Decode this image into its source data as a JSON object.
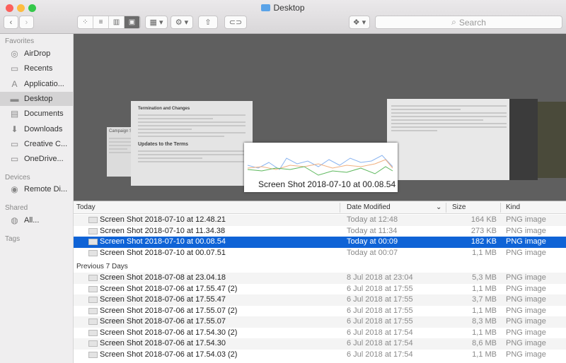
{
  "window": {
    "title": "Desktop"
  },
  "toolbar": {
    "back": "‹",
    "forward": "›",
    "views": [
      "icon-view",
      "list-view",
      "column-view",
      "cover-flow-view"
    ],
    "active_view": "cover-flow-view",
    "search_placeholder": "Search"
  },
  "sidebar": {
    "favorites_label": "Favorites",
    "favorites": [
      {
        "label": "AirDrop",
        "icon": "airdrop-icon"
      },
      {
        "label": "Recents",
        "icon": "recents-icon"
      },
      {
        "label": "Applicatio...",
        "icon": "applications-icon"
      },
      {
        "label": "Desktop",
        "icon": "desktop-icon",
        "selected": true
      },
      {
        "label": "Documents",
        "icon": "documents-icon"
      },
      {
        "label": "Downloads",
        "icon": "downloads-icon"
      },
      {
        "label": "Creative C...",
        "icon": "folder-icon"
      },
      {
        "label": "OneDrive...",
        "icon": "folder-icon"
      }
    ],
    "devices_label": "Devices",
    "devices": [
      {
        "label": "Remote Di...",
        "icon": "disc-icon"
      }
    ],
    "shared_label": "Shared",
    "shared": [
      {
        "label": "All...",
        "icon": "network-icon"
      }
    ],
    "tags_label": "Tags"
  },
  "coverflow": {
    "caption": "Screen Shot 2018-07-10 at 00.08.54",
    "doc_heading1": "Termination and Changes",
    "doc_heading2": "Updates to the Terms",
    "campaign_heading": "Campaign S"
  },
  "list": {
    "columns": {
      "name": "Today",
      "date": "Date Modified",
      "size": "Size",
      "kind": "Kind"
    },
    "groups": [
      {
        "label": "Today",
        "rows": [
          {
            "name": "Screen Shot 2018-07-10 at 12.48.21",
            "date": "Today at 12:48",
            "size": "164 KB",
            "kind": "PNG image"
          },
          {
            "name": "Screen Shot 2018-07-10 at 11.34.38",
            "date": "Today at 11:34",
            "size": "273 KB",
            "kind": "PNG image"
          },
          {
            "name": "Screen Shot 2018-07-10 at 00.08.54",
            "date": "Today at 00:09",
            "size": "182 KB",
            "kind": "PNG image",
            "selected": true
          },
          {
            "name": "Screen Shot 2018-07-10 at 00.07.51",
            "date": "Today at 00:07",
            "size": "1,1 MB",
            "kind": "PNG image"
          }
        ]
      },
      {
        "label": "Previous 7 Days",
        "rows": [
          {
            "name": "Screen Shot 2018-07-08 at 23.04.18",
            "date": "8 Jul 2018 at 23:04",
            "size": "5,3 MB",
            "kind": "PNG image"
          },
          {
            "name": "Screen Shot 2018-07-06 at 17.55.47 (2)",
            "date": "6 Jul 2018 at 17:55",
            "size": "1,1 MB",
            "kind": "PNG image"
          },
          {
            "name": "Screen Shot 2018-07-06 at 17.55.47",
            "date": "6 Jul 2018 at 17:55",
            "size": "3,7 MB",
            "kind": "PNG image"
          },
          {
            "name": "Screen Shot 2018-07-06 at 17.55.07 (2)",
            "date": "6 Jul 2018 at 17:55",
            "size": "1,1 MB",
            "kind": "PNG image"
          },
          {
            "name": "Screen Shot 2018-07-06 at 17.55.07",
            "date": "6 Jul 2018 at 17:55",
            "size": "8,3 MB",
            "kind": "PNG image"
          },
          {
            "name": "Screen Shot 2018-07-06 at 17.54.30 (2)",
            "date": "6 Jul 2018 at 17:54",
            "size": "1,1 MB",
            "kind": "PNG image"
          },
          {
            "name": "Screen Shot 2018-07-06 at 17.54.30",
            "date": "6 Jul 2018 at 17:54",
            "size": "8,6 MB",
            "kind": "PNG image"
          },
          {
            "name": "Screen Shot 2018-07-06 at 17.54.03 (2)",
            "date": "6 Jul 2018 at 17:54",
            "size": "1,1 MB",
            "kind": "PNG image"
          }
        ]
      }
    ]
  },
  "colors": {
    "selection": "#0f63d6",
    "coverflow_bg": "#5f5f5f"
  }
}
